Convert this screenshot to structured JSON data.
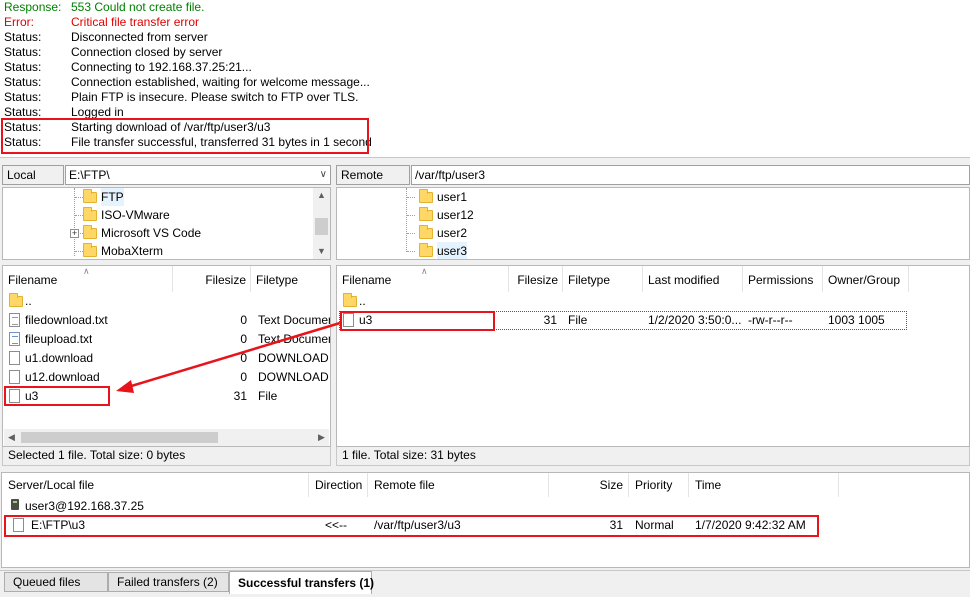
{
  "log": [
    {
      "kind": "Response:",
      "message": "553 Could not create file.",
      "type": "response"
    },
    {
      "kind": "Error:",
      "message": "Critical file transfer error",
      "type": "error"
    },
    {
      "kind": "Status:",
      "message": "Disconnected from server",
      "type": "status"
    },
    {
      "kind": "Status:",
      "message": "Connection closed by server",
      "type": "status"
    },
    {
      "kind": "Status:",
      "message": "Connecting to 192.168.37.25:21...",
      "type": "status"
    },
    {
      "kind": "Status:",
      "message": "Connection established, waiting for welcome message...",
      "type": "status"
    },
    {
      "kind": "Status:",
      "message": "Plain FTP is insecure. Please switch to FTP over TLS.",
      "type": "status"
    },
    {
      "kind": "Status:",
      "message": "Logged in",
      "type": "status"
    },
    {
      "kind": "Status:",
      "message": "Starting download of /var/ftp/user3/u3",
      "type": "status"
    },
    {
      "kind": "Status:",
      "message": "File transfer successful, transferred 31 bytes in 1 second",
      "type": "status"
    }
  ],
  "local": {
    "site_label": "Local site:",
    "site_path": "E:\\FTP\\",
    "tree": [
      "FTP",
      "ISO-VMware",
      "Microsoft VS Code",
      "MobaXterm"
    ],
    "columns": {
      "filename": "Filename",
      "filesize": "Filesize",
      "filetype": "Filetype"
    },
    "files": [
      {
        "name": "..",
        "size": "",
        "type": "",
        "icon": "folder-icon"
      },
      {
        "name": "filedownload.txt",
        "size": "0",
        "type": "Text Document",
        "icon": "text-file-icon"
      },
      {
        "name": "fileupload.txt",
        "size": "0",
        "type": "Text Document",
        "icon": "text-file-icon"
      },
      {
        "name": "u1.download",
        "size": "0",
        "type": "DOWNLOAD ...",
        "icon": "file-icon"
      },
      {
        "name": "u12.download",
        "size": "0",
        "type": "DOWNLOAD ...",
        "icon": "file-icon"
      },
      {
        "name": "u3",
        "size": "31",
        "type": "File",
        "icon": "file-icon"
      }
    ],
    "status": "Selected 1 file. Total size: 0 bytes"
  },
  "remote": {
    "site_label": "Remote site:",
    "site_path": "/var/ftp/user3",
    "tree": [
      "user1",
      "user12",
      "user2",
      "user3"
    ],
    "columns": {
      "filename": "Filename",
      "filesize": "Filesize",
      "filetype": "Filetype",
      "modified": "Last modified",
      "permissions": "Permissions",
      "owner": "Owner/Group"
    },
    "files": [
      {
        "name": "..",
        "size": "",
        "type": "",
        "modified": "",
        "permissions": "",
        "owner": "",
        "icon": "folder-icon"
      },
      {
        "name": "u3",
        "size": "31",
        "type": "File",
        "modified": "1/2/2020 3:50:0...",
        "permissions": "-rw-r--r--",
        "owner": "1003 1005",
        "icon": "file-icon"
      }
    ],
    "status": "1 file. Total size: 31 bytes"
  },
  "queue": {
    "columns": {
      "server": "Server/Local file",
      "direction": "Direction",
      "remote": "Remote file",
      "size": "Size",
      "priority": "Priority",
      "time": "Time"
    },
    "server": "user3@192.168.37.25",
    "items": [
      {
        "local": "E:\\FTP\\u3",
        "direction": "<<--",
        "remote": "/var/ftp/user3/u3",
        "size": "31",
        "priority": "Normal",
        "time": "1/7/2020 9:42:32 AM"
      }
    ]
  },
  "tabs": [
    "Queued files",
    "Failed transfers (2)",
    "Successful transfers (1)"
  ],
  "colors": {
    "highlight": "#e8141b",
    "response": "#008000",
    "error": "#e00000"
  }
}
